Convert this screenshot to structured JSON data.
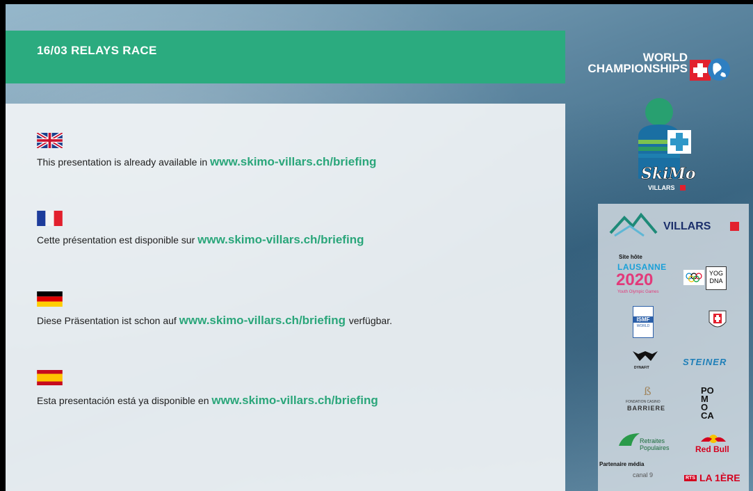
{
  "header": {
    "title": "16/03  RELAYS RACE"
  },
  "languages": [
    {
      "flag": "uk-flag",
      "text": "This presentation is already available in ",
      "link": "www.skimo-villars.ch/briefing",
      "suffix": ""
    },
    {
      "flag": "france-flag",
      "text": "Cette présentation est disponible sur ",
      "link": "www.skimo-villars.ch/briefing",
      "suffix": ""
    },
    {
      "flag": "germany-flag",
      "text": "Diese Präsentation ist schon auf ",
      "link": "www.skimo-villars.ch/briefing ",
      "suffix": "verfügbar."
    },
    {
      "flag": "spain-flag",
      "text": "Esta presentación está ya disponible en ",
      "link": "www.skimo-villars.ch/briefing",
      "suffix": ""
    }
  ],
  "branding": {
    "worlds_line1": "WORLD",
    "worlds_line2": "CHAMPIONSHIPS",
    "skimo_name": "SkiMo",
    "skimo_sub": "VILLARS",
    "villars": "VILLARS",
    "site_hote": "Site hôte",
    "lausanne": "LAUSANNE",
    "year": "2020",
    "yog_sub": "Youth Olympic Games",
    "yog_box": "YOG\nDNA",
    "ismf": "ISMF",
    "world": "WORLD",
    "dynafit": "DYNAFIT",
    "steiner": "STEINER",
    "barriere_top": "FONDATION CASINO",
    "barriere": "BARRIERE",
    "pomoca": "PO MO CA",
    "retraites": "Retraites Populaires",
    "redbull": "Red Bull",
    "partenaire": "Partenaire média",
    "canal9": "canal 9",
    "rts": "RTS",
    "lapremiere": "LA 1ÈRE"
  },
  "colors": {
    "accent": "#2bab7f",
    "link": "#2aa67a"
  }
}
